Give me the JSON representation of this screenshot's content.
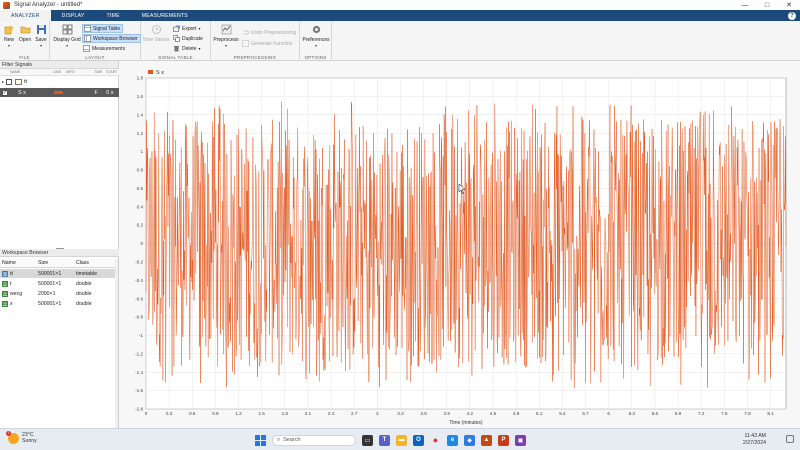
{
  "window": {
    "title": "Signal Analyzer - untitled*",
    "min": "—",
    "max": "□",
    "close": "✕"
  },
  "tabs": [
    {
      "label": "ANALYZER",
      "active": true
    },
    {
      "label": "DISPLAY",
      "active": false
    },
    {
      "label": "TIME",
      "active": false
    },
    {
      "label": "MEASUREMENTS",
      "active": false
    }
  ],
  "ribbon": {
    "file": {
      "label": "FILE",
      "new": "New",
      "open": "Open",
      "save": "Save"
    },
    "layout": {
      "label": "LAYOUT",
      "display_grid": "Display Grid",
      "signal_table": "Signal Table",
      "workspace_browser": "Workspace Browser",
      "measurements": "Measurements"
    },
    "signal_table": {
      "label": "SIGNAL TABLE",
      "time_values": "Time Values",
      "export": "Export",
      "duplicate": "Duplicate",
      "delete": "Delete"
    },
    "preprocessing": {
      "label": "PREPROCESSING",
      "preprocess": "Preprocess",
      "undo": "Undo Preprocessing",
      "generate": "Generate Function"
    },
    "options": {
      "label": "OPTIONS",
      "preferences": "Preferences"
    }
  },
  "signal_pane": {
    "header": "Filter Signals",
    "columns": [
      "NAME",
      "LINE",
      "INFO",
      "TIME",
      "START"
    ],
    "rows": [
      {
        "name": "tt",
        "line": "",
        "info": "",
        "time": "",
        "start": "",
        "checked": false,
        "selected": false
      },
      {
        "name": "S x",
        "line": "",
        "info": "",
        "time": "F",
        "start": "0 s",
        "checked": true,
        "selected": true
      }
    ]
  },
  "workspace": {
    "header": "Workspace Browser",
    "columns": [
      "Name",
      "Size",
      "Class"
    ],
    "rows": [
      {
        "name": "tt",
        "size": "500001×1",
        "class": "timetable",
        "selected": true,
        "icon": "timetable-icon"
      },
      {
        "name": "t",
        "size": "500001×1",
        "class": "double",
        "selected": false,
        "icon": "matrix-icon"
      },
      {
        "name": "wecg",
        "size": "2000×1",
        "class": "double",
        "selected": false,
        "icon": "matrix-icon"
      },
      {
        "name": "x",
        "size": "500001×1",
        "class": "double",
        "selected": false,
        "icon": "matrix-icon"
      }
    ]
  },
  "chart_data": {
    "type": "line",
    "legend": "S x",
    "legend_position": "top-left",
    "xlabel": "Time (minutes)",
    "ylabel": "",
    "title": "",
    "xlim": [
      0,
      8.3
    ],
    "ylim": [
      -1.8,
      1.8
    ],
    "x_ticks": [
      "0",
      "0.3",
      "0.6",
      "0.9",
      "1.2",
      "1.5",
      "1.8",
      "2.1",
      "2.4",
      "2.7",
      "3",
      "3.3",
      "3.6",
      "3.9",
      "4.2",
      "4.5",
      "4.8",
      "5.1",
      "5.4",
      "5.7",
      "6",
      "6.3",
      "6.6",
      "6.9",
      "7.2",
      "7.5",
      "7.8",
      "8.1"
    ],
    "y_ticks": [
      "1.8",
      "1.6",
      "1.4",
      "1.2",
      "1",
      "0.8",
      "0.6",
      "0.4",
      "0.2",
      "0",
      "-0.2",
      "-0.4",
      "-0.6",
      "-0.8",
      "-1",
      "-1.2",
      "-1.4",
      "-1.6",
      "-1.8"
    ],
    "grid": true,
    "series": [
      {
        "name": "S x",
        "color": "#e2571d",
        "band_upper": 1.35,
        "band_lower": -1.35,
        "peak_upper": 1.55,
        "peak_lower": -1.6
      }
    ]
  },
  "taskbar": {
    "temp": "23°C",
    "weather": "Sunny",
    "badge": "1",
    "search": "Search",
    "time": "11:43 AM",
    "date": "2/27/2024"
  }
}
